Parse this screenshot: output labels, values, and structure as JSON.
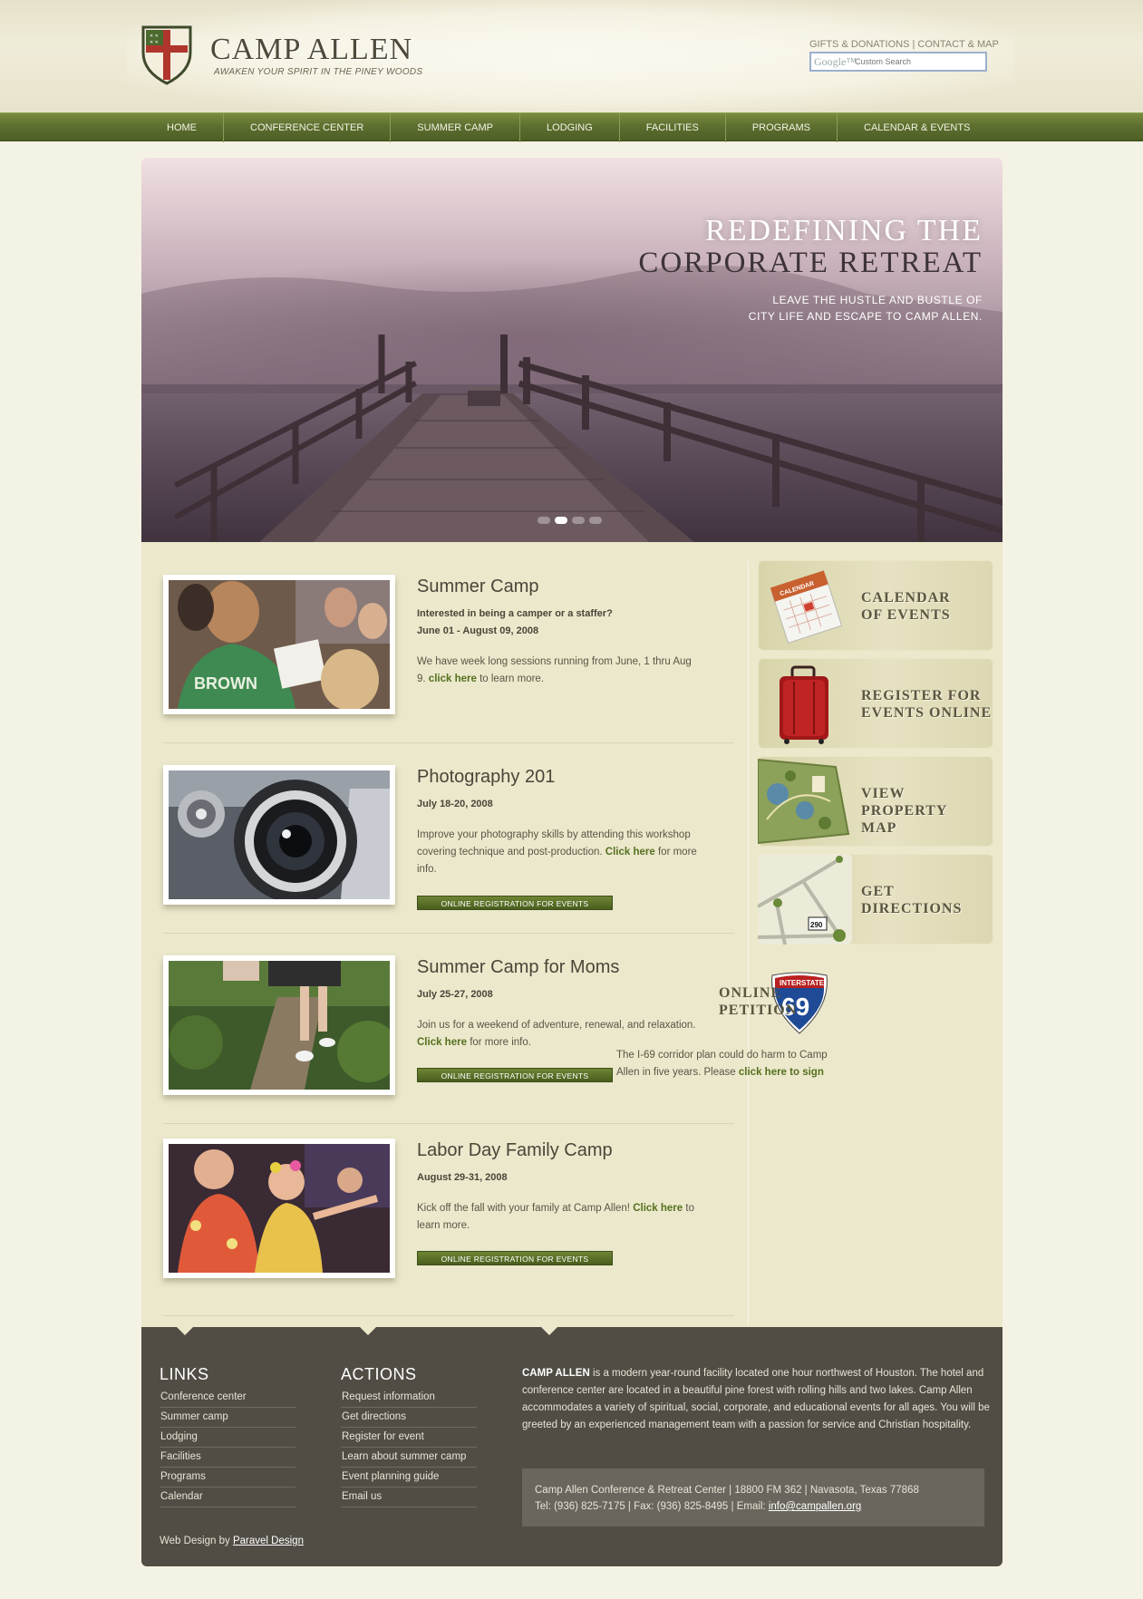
{
  "header": {
    "site_name": "CAMP ALLEN",
    "tagline": "AWAKEN YOUR SPIRIT IN THE PINEY WOODS",
    "util_gifts": "GIFTS & DONATIONS",
    "util_sep": "|",
    "util_contact": "CONTACT & MAP",
    "search_brand": "Google™",
    "search_placeholder": "Custom Search"
  },
  "nav": {
    "items": [
      "HOME",
      "CONFERENCE CENTER",
      "SUMMER CAMP",
      "LODGING",
      "FACILITIES",
      "PROGRAMS",
      "CALENDAR & EVENTS"
    ]
  },
  "hero": {
    "title_line1": "REDEFINING THE",
    "title_line2": "CORPORATE RETREAT",
    "subtitle": "LEAVE THE HUSTLE AND BUSTLE OF CITY LIFE AND ESCAPE TO CAMP ALLEN.",
    "slides_total": 4,
    "active_slide": 2
  },
  "events": [
    {
      "title": "Summer Camp",
      "meta1": "Interested in being a camper or a staffer?",
      "meta2": "June 01 - August 09, 2008",
      "desc_pre": "We have week long sessions running from June, 1 thru Aug 9.",
      "link": "click here",
      "desc_post": "to learn more."
    },
    {
      "title": "Photography 201",
      "meta1": "July 18-20, 2008",
      "desc_pre": "Improve your photography skills by attending this workshop covering technique and post-production.",
      "link": "Click here",
      "desc_post": "for more info.",
      "button": "ONLINE REGISTRATION FOR EVENTS"
    },
    {
      "title": "Summer Camp for Moms",
      "meta1": "July 25-27, 2008",
      "desc_pre": "Join us for a weekend of adventure, renewal, and relaxation.",
      "link": "Click here",
      "desc_post": "for more info.",
      "button": "ONLINE REGISTRATION FOR EVENTS"
    },
    {
      "title": "Labor Day Family Camp",
      "meta1": "August 29-31, 2008",
      "desc_pre": "Kick off the fall with your family at Camp Allen!",
      "link": "Click here",
      "desc_post": "to learn more.",
      "button": "ONLINE REGISTRATION FOR EVENTS"
    }
  ],
  "sidebar": {
    "calendar_line1": "CALENDAR",
    "calendar_line2": "OF EVENTS",
    "calendar_icon_text": "CALENDAR",
    "register_line1": "REGISTER FOR",
    "register_line2": "EVENTS ONLINE",
    "map_line1": "VIEW PROPERTY",
    "map_line2": "MAP",
    "directions_line1": "GET",
    "directions_line2": "DIRECTIONS",
    "petition_line1": "ONLINE",
    "petition_line2": "PETITION",
    "interstate_label": "INTERSTATE",
    "interstate_number": "69",
    "highway_number": "290",
    "petition_text_pre": "The I-69 corridor plan could do harm to Camp Allen in five years. Please",
    "petition_link": "click here to sign"
  },
  "footer": {
    "links_heading": "LINKS",
    "links": [
      "Conference center",
      "Summer camp",
      "Lodging",
      "Facilities",
      "Programs",
      "Calendar"
    ],
    "actions_heading": "ACTIONS",
    "actions": [
      "Request information",
      "Get directions",
      "Register for event",
      "Learn about summer camp",
      "Event planning guide",
      "Email us"
    ],
    "about_name": "CAMP ALLEN",
    "about_text": "is a modern year-round facility located one hour northwest of Houston. The hotel and conference center are located in a beautiful pine forest with rolling hills and two lakes. Camp Allen accommodates a variety of spiritual, social, corporate, and educational events for all ages. You will be greeted by an experienced management team with a passion for service and Christian hospitality.",
    "contact_line1": "Camp Allen Conference & Retreat Center | 18800 FM 362 | Navasota, Texas 77868",
    "contact_line2_pre": "Tel: (936) 825-7175 | Fax: (936) 825-8495 | Email:",
    "contact_email": "info@campallen.org",
    "credit_pre": "Web Design by",
    "credit_link": "Paravel Design"
  },
  "colors": {
    "nav_green": "#5e7030",
    "content_bg": "#ebe8cc",
    "footer_bg": "#514d45",
    "link_green": "#55701e"
  }
}
